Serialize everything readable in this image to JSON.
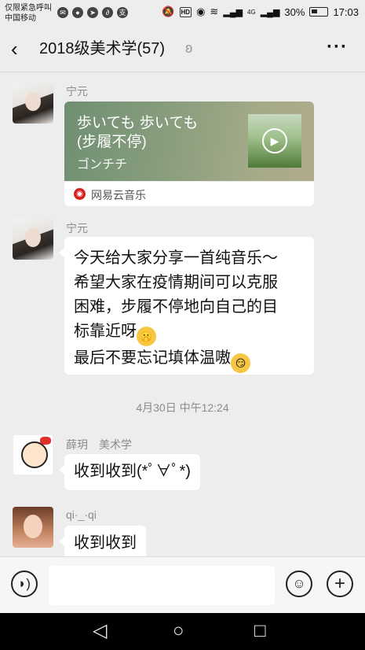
{
  "status_bar": {
    "carrier_line1": "仅限紧急呼叫",
    "carrier_line2": "中国移动",
    "app_icons": [
      "wechat-icon",
      "qq-icon",
      "feishu-icon",
      "baidu-icon",
      "alipay-icon"
    ],
    "network": "4G",
    "battery": "30%",
    "time": "17:03"
  },
  "header": {
    "title": "2018级美术学(57)",
    "muted_icon": "ear-icon",
    "more_icon": "more-icon"
  },
  "messages": [
    {
      "type": "music_card",
      "sender": "宁元",
      "song_line1": "歩いても 歩いても",
      "song_line2": "(步履不停)",
      "artist": "ゴンチチ",
      "source": "网易云音乐"
    },
    {
      "type": "text",
      "sender": "宁元",
      "lines": [
        "今天给大家分享一首纯音乐～",
        "希望大家在疫情期间可以克服",
        "困难，步履不停地向自己的目",
        "标靠近呀",
        "最后不要忘记填体温嗷"
      ]
    },
    {
      "type": "timestamp",
      "text": "4月30日 中午12:24"
    },
    {
      "type": "text",
      "sender": "薛玥　美术学",
      "lines": [
        "收到收到(*ﾟ∀ﾟ*)"
      ]
    },
    {
      "type": "text",
      "sender": "qi·_·qi",
      "lines": [
        "收到收到"
      ]
    }
  ],
  "input_bar": {
    "voice_icon": "voice-icon",
    "emoji_icon": "emoji-icon",
    "add_icon": "plus-icon",
    "placeholder": ""
  },
  "nav_bar": {
    "back": "◁",
    "home": "○",
    "recents": "□"
  }
}
